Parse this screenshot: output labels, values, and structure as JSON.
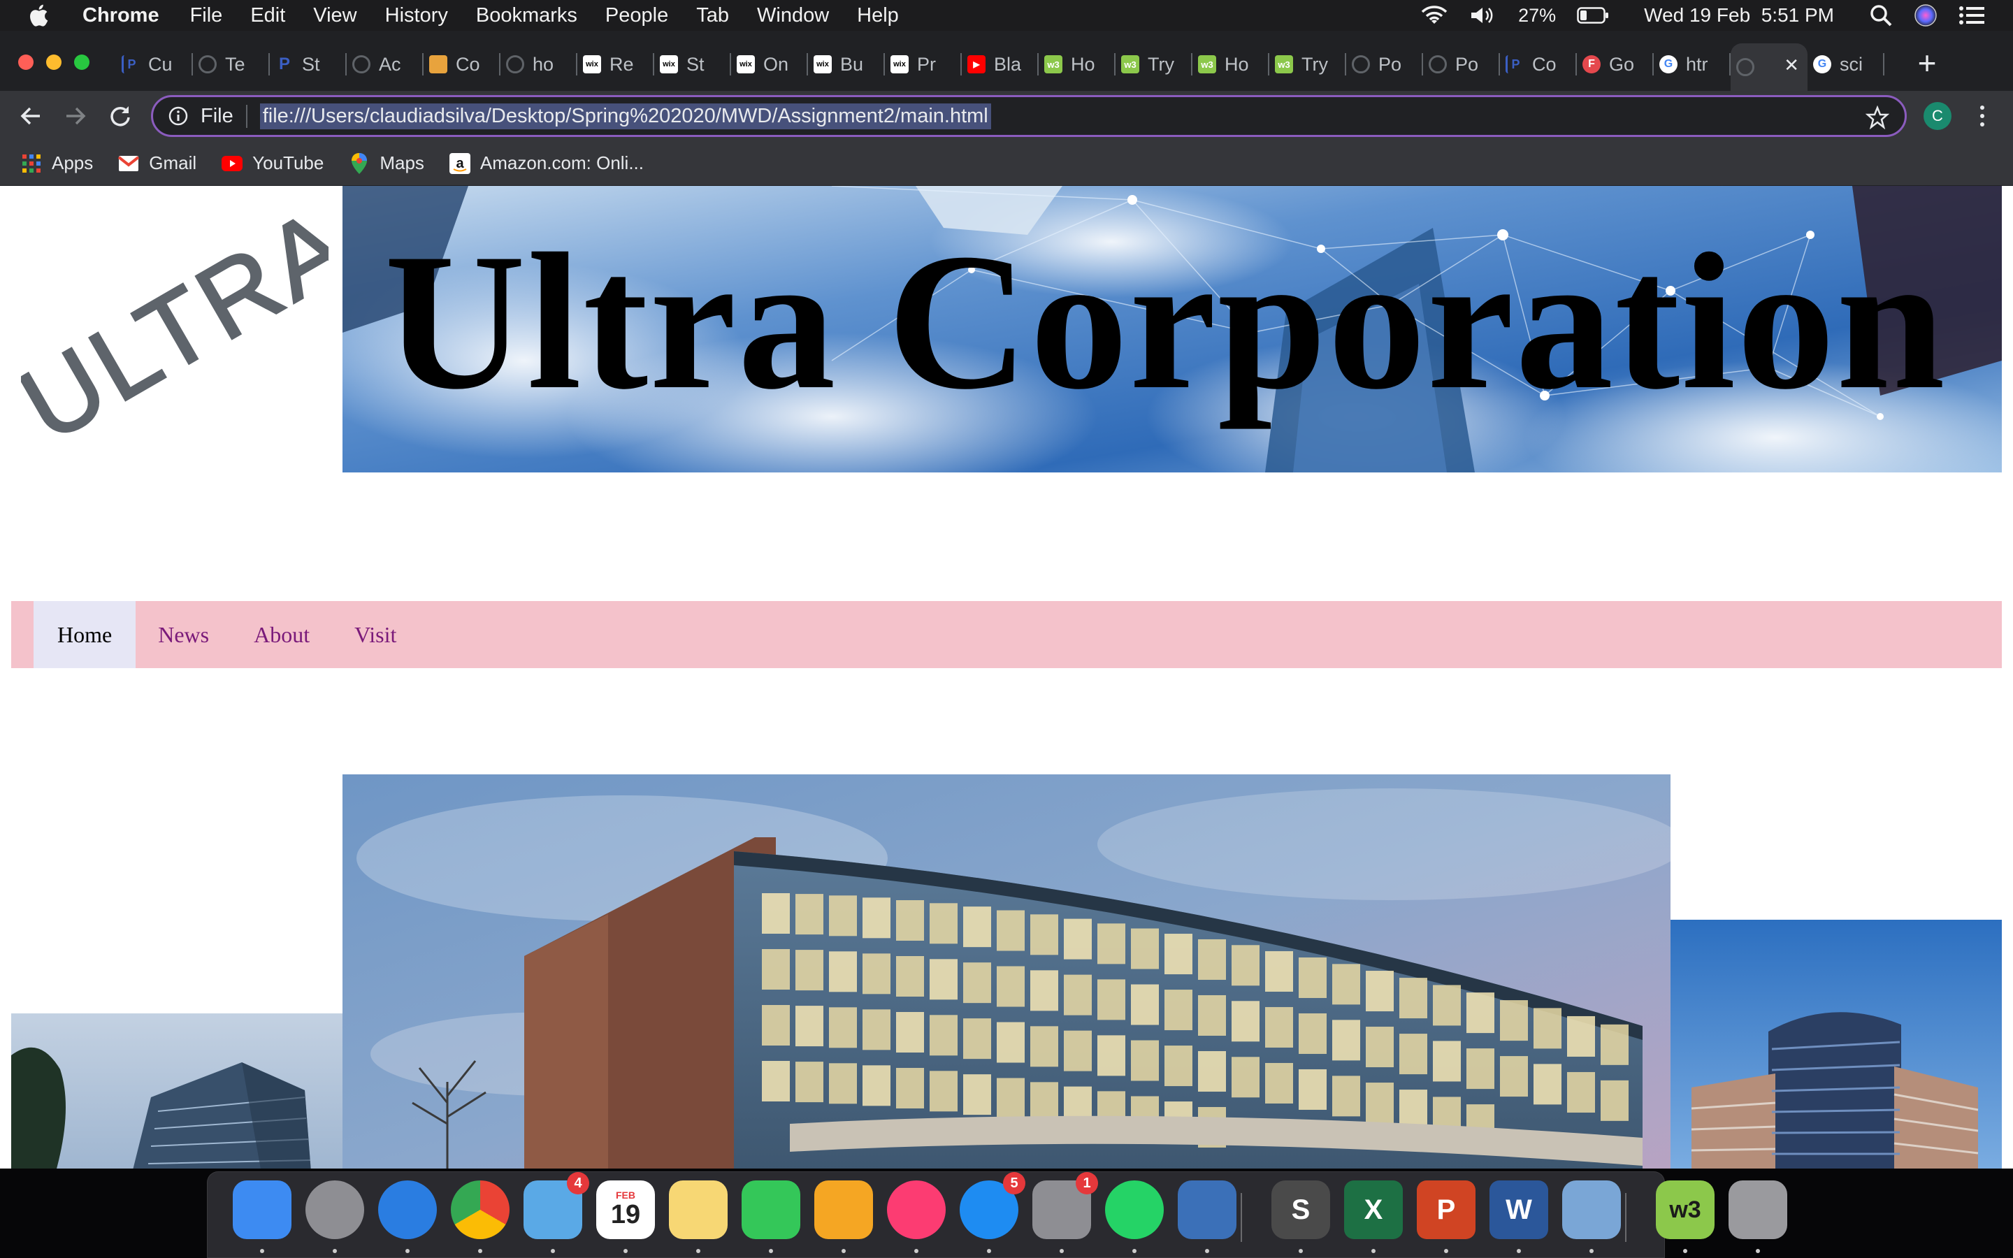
{
  "menubar": {
    "app_name": "Chrome",
    "items": [
      "File",
      "Edit",
      "View",
      "History",
      "Bookmarks",
      "People",
      "Tab",
      "Window",
      "Help"
    ],
    "battery": "27%",
    "datetime": "Wed 19 Feb  5:51 PM"
  },
  "tabs": [
    {
      "title": "Cu",
      "icon": "pearson-icon",
      "color": "#2a4f9e"
    },
    {
      "title": "Te",
      "icon": "globe-icon",
      "color": "#5f6368"
    },
    {
      "title": "St",
      "icon": "p-icon",
      "color": "#1f3c88"
    },
    {
      "title": "Ac",
      "icon": "globe-icon",
      "color": "#5f6368"
    },
    {
      "title": "Co",
      "icon": "pencil-icon",
      "color": "#e8a33d"
    },
    {
      "title": "ho",
      "icon": "globe-icon",
      "color": "#5f6368"
    },
    {
      "title": "Re",
      "icon": "wix-icon",
      "color": "#ffffff"
    },
    {
      "title": "St",
      "icon": "wix-icon",
      "color": "#ffffff"
    },
    {
      "title": "On",
      "icon": "wix-icon",
      "color": "#ffffff"
    },
    {
      "title": "Bu",
      "icon": "wix-icon",
      "color": "#ffffff"
    },
    {
      "title": "Pr",
      "icon": "wix-icon",
      "color": "#ffffff"
    },
    {
      "title": "Bla",
      "icon": "youtube-icon",
      "color": "#ff0000"
    },
    {
      "title": "Ho",
      "icon": "w3schools-icon",
      "color": "#8cc84b"
    },
    {
      "title": "Try",
      "icon": "w3schools-icon",
      "color": "#8cc84b"
    },
    {
      "title": "Ho",
      "icon": "w3schools-icon",
      "color": "#8cc84b"
    },
    {
      "title": "Try",
      "icon": "w3schools-icon",
      "color": "#8cc84b"
    },
    {
      "title": "Po",
      "icon": "globe-icon",
      "color": "#5f6368"
    },
    {
      "title": "Po",
      "icon": "globe-icon",
      "color": "#5f6368"
    },
    {
      "title": "Co",
      "icon": "pearson-icon",
      "color": "#2a4f9e"
    },
    {
      "title": "Go",
      "icon": "f-icon",
      "color": "#e5484d"
    },
    {
      "title": "htr",
      "icon": "google-icon",
      "color": "#ffffff"
    },
    {
      "title": "",
      "icon": "globe-icon",
      "color": "#5f6368",
      "active": true
    },
    {
      "title": "sci",
      "icon": "google-icon",
      "color": "#ffffff"
    }
  ],
  "toolbar": {
    "chip": "File",
    "url": "file:///Users/claudiadsilva/Desktop/Spring%202020/MWD/Assignment2/main.html",
    "profile_initial": "C"
  },
  "bookmarks": [
    {
      "label": "Apps",
      "icon": "apps-grid-icon"
    },
    {
      "label": "Gmail",
      "icon": "gmail-icon"
    },
    {
      "label": "YouTube",
      "icon": "youtube-icon"
    },
    {
      "label": "Maps",
      "icon": "maps-pin-icon"
    },
    {
      "label": "Amazon.com: Onli...",
      "icon": "amazon-icon"
    }
  ],
  "page": {
    "logo_text": "ULTRA",
    "banner_title": "Ultra Corporation",
    "nav": [
      "Home",
      "News",
      "About",
      "Visit"
    ],
    "nav_active": "Home",
    "colors": {
      "nav_bg": "#f4c2cb",
      "nav_link": "#7a1a7a",
      "nav_active_bg": "#e6e6f5"
    }
  },
  "dock": {
    "apps": [
      {
        "name": "finder-icon",
        "label": "",
        "color": "#3d8bf2"
      },
      {
        "name": "launchpad-icon",
        "label": "",
        "color": "#8e8e93"
      },
      {
        "name": "safari-icon",
        "label": "",
        "color": "#2a7de1"
      },
      {
        "name": "chrome-icon",
        "label": "",
        "color": "#ffffff"
      },
      {
        "name": "mail-icon",
        "label": "",
        "color": "#5aa9e6",
        "badge": "4"
      },
      {
        "name": "calendar-icon",
        "label": "19",
        "color": "#ffffff"
      },
      {
        "name": "notes-icon",
        "label": "",
        "color": "#f7d774"
      },
      {
        "name": "facetime-icon",
        "label": "",
        "color": "#34c759"
      },
      {
        "name": "pages-icon",
        "label": "",
        "color": "#f5a623"
      },
      {
        "name": "itunes-icon",
        "label": "",
        "color": "#fc3c72"
      },
      {
        "name": "app-store-icon",
        "label": "",
        "color": "#1e8cf2",
        "badge": "5"
      },
      {
        "name": "system-preferences-icon",
        "label": "",
        "color": "#8e8e93",
        "badge": "1"
      },
      {
        "name": "whatsapp-icon",
        "label": "",
        "color": "#25d366"
      },
      {
        "name": "virtualbox-icon",
        "label": "",
        "color": "#3b70b8"
      },
      {
        "name": "sublime-text-icon",
        "label": "S",
        "color": "#4a4a4a"
      },
      {
        "name": "excel-icon",
        "label": "X",
        "color": "#1d7044"
      },
      {
        "name": "powerpoint-icon",
        "label": "P",
        "color": "#d04423"
      },
      {
        "name": "word-icon",
        "label": "W",
        "color": "#2b579a"
      },
      {
        "name": "preview-icon",
        "label": "",
        "color": "#7aa6d6"
      },
      {
        "name": "w3schools-icon",
        "label": "w3",
        "color": "#8cc84b"
      },
      {
        "name": "trash-icon",
        "label": "",
        "color": "#9a9a9e"
      }
    ],
    "calendar_month": "FEB"
  }
}
